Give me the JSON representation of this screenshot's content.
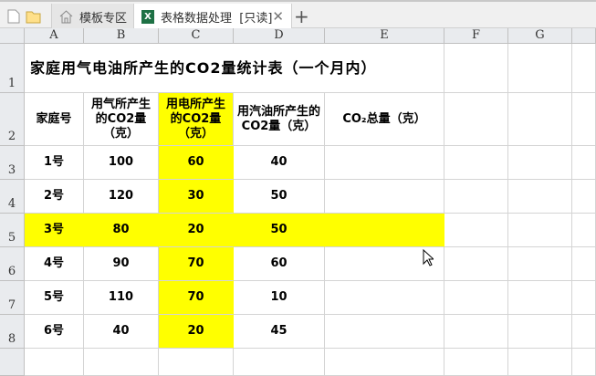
{
  "tabs": [
    {
      "label": "模板专区",
      "icon": "home-icon"
    },
    {
      "label": "表格数据处理  [只读]",
      "icon": "excel-icon"
    }
  ],
  "xl_badge": "X",
  "close_glyph": "✕",
  "new_tab_glyph": "+",
  "columns": [
    "A",
    "B",
    "C",
    "D",
    "E",
    "F",
    "G"
  ],
  "rows": [
    "1",
    "2",
    "3",
    "4",
    "5",
    "6",
    "7",
    "8"
  ],
  "title": "家庭用气电油所产生的CO2量统计表（一个月内）",
  "headers": [
    "家庭号",
    "用气所产生的CO2量（克）",
    "用电所产生的CO2量（克）",
    "用汽油所产生的CO2量（克）",
    "CO₂总量（克）"
  ],
  "data": [
    [
      "1号",
      "100",
      "60",
      "40",
      ""
    ],
    [
      "2号",
      "120",
      "30",
      "50",
      ""
    ],
    [
      "3号",
      "80",
      "20",
      "50",
      ""
    ],
    [
      "4号",
      "90",
      "70",
      "60",
      ""
    ],
    [
      "5号",
      "110",
      "70",
      "10",
      ""
    ],
    [
      "6号",
      "40",
      "20",
      "45",
      ""
    ]
  ],
  "highlight_color": "#ffff00"
}
